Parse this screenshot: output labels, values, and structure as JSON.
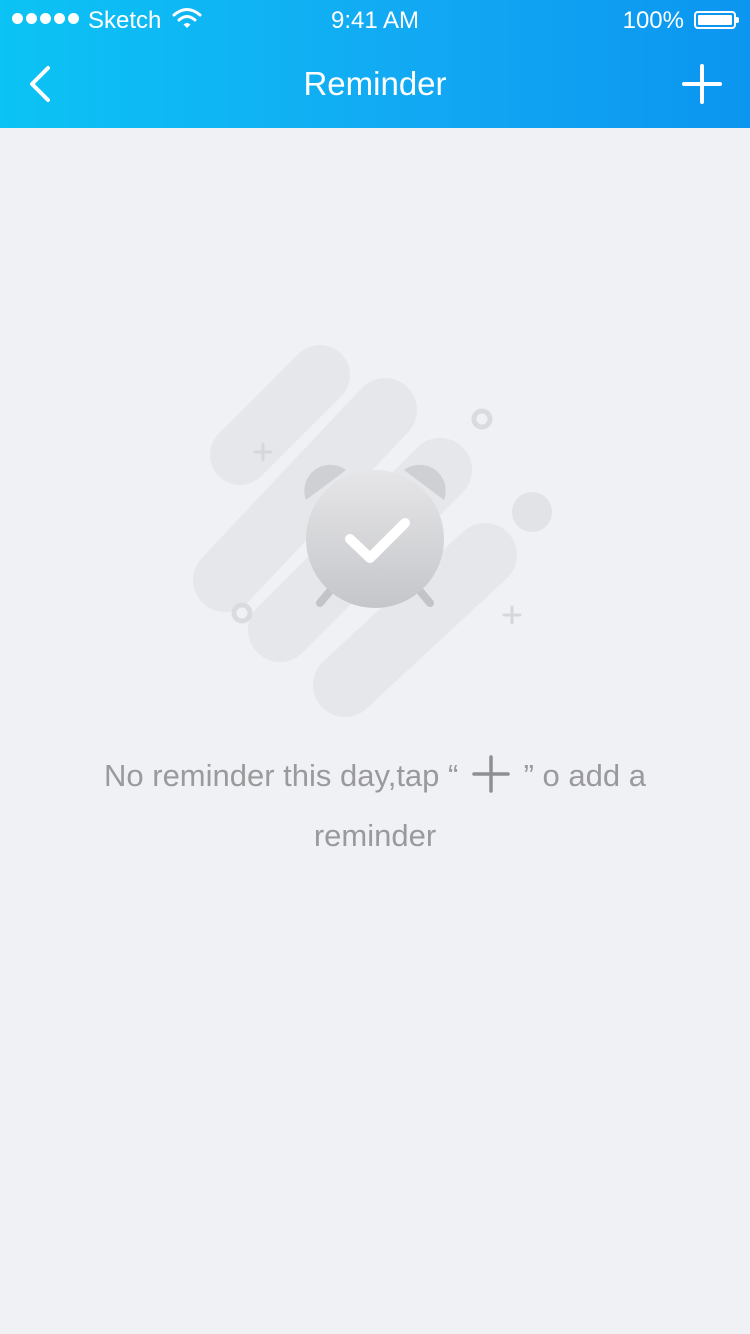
{
  "status_bar": {
    "carrier": "Sketch",
    "time": "9:41 AM",
    "battery": "100%",
    "battery_level": 1.0,
    "signal_bars": 5
  },
  "header": {
    "title": "Reminder",
    "back_icon": "chevron-left-icon",
    "add_icon": "plus-icon",
    "gradient_start": "#0bc3f4",
    "gradient_end": "#0b95f0"
  },
  "empty_state": {
    "illustration_icon": "alarm-clock-check-icon",
    "message_before": "No reminder this day,tap “",
    "message_after": "” o add a reminder",
    "text_color": "#9a9a9c"
  },
  "colors": {
    "background": "#f0f1f5"
  }
}
